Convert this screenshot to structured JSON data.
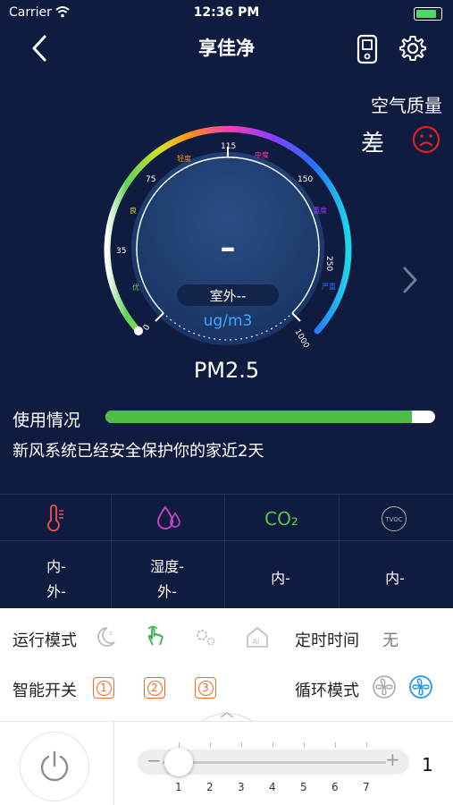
{
  "status_bar": {
    "carrier": "Carrier",
    "time": "12:36 PM"
  },
  "nav": {
    "title": "享佳净",
    "back_icon": "chevron-left-icon",
    "device_icon": "device-icon",
    "settings_icon": "gear-icon"
  },
  "air_quality": {
    "label": "空气质量",
    "value": "差",
    "face_icon": "sad-face-icon",
    "face_color": "#e02020"
  },
  "gauge": {
    "value": "–",
    "location_label": "室外--",
    "unit": "ug/m3",
    "scale_labels": [
      "0",
      "35",
      "75",
      "115",
      "150",
      "250",
      "1000"
    ],
    "level_labels": [
      "优",
      "良",
      "轻度",
      "中度",
      "重度",
      "严重"
    ],
    "metric": "PM2.5",
    "next_icon": "chevron-right-icon"
  },
  "usage": {
    "label": "使用情况",
    "progress": 0.93,
    "bar_color": "#4bbf45",
    "message": "新风系统已经安全保护你的家近2天"
  },
  "sensors": [
    {
      "icon": "thermometer-icon",
      "icon_color": "#e04b4b",
      "line1": "内-",
      "line2": "外-"
    },
    {
      "icon": "humidity-icon",
      "icon_color": "#c33ec7",
      "line1": "湿度-",
      "line2": "外-"
    },
    {
      "icon": "co2-icon",
      "icon_text": "CO₂",
      "icon_color": "#5cc34f",
      "line1": "内-",
      "line2": ""
    },
    {
      "icon": "tvoc-icon",
      "icon_text": "TVOC",
      "icon_color": "#aaaaaa",
      "line1": "内-",
      "line2": ""
    }
  ],
  "controls": {
    "run_mode_label": "运行模式",
    "run_modes": [
      "sleep-mode-icon",
      "manual-mode-icon",
      "auto-mode-icon",
      "ai-mode-icon"
    ],
    "timer_label": "定时时间",
    "timer_value": "无",
    "smart_switch_label": "智能开关",
    "smart_switches": [
      "1",
      "2",
      "3"
    ],
    "cycle_mode_label": "循环模式",
    "cycle_modes": [
      "internal-cycle-icon",
      "external-cycle-icon"
    ],
    "collapse_icon": "chevron-up-icon"
  },
  "speed": {
    "minus": "−",
    "plus": "+",
    "ticks": [
      "1",
      "2",
      "3",
      "4",
      "5",
      "6",
      "7"
    ],
    "value": "1",
    "power_icon": "power-icon"
  }
}
